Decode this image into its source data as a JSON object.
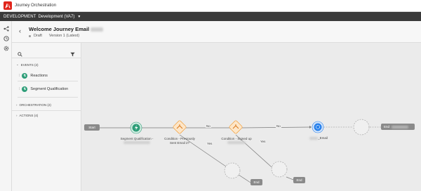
{
  "app": {
    "title": "Journey Orchestration"
  },
  "env": {
    "label": "DEVELOPMENT",
    "name": "Development (VA7)"
  },
  "journey": {
    "title": "Welcome Journey Email",
    "status": "Draft",
    "version": "Version 1 (Latest)"
  },
  "panel": {
    "events_section": "EVENTS (2)",
    "events": [
      "Reactions",
      "Segment Qualification"
    ],
    "orchestration_section": "ORCHESTRATION (2)",
    "actions_section": "ACTIONS (4)"
  },
  "canvas": {
    "start_label": "Start",
    "segment_label_1": "Segment Qualification -",
    "condition1_label_1": "Condition - Previously",
    "condition1_label_2": "Sent Email 2?",
    "condition2_label": "Condition - Signed up",
    "email_label": "_Email",
    "end_label": "End",
    "no_label": "No",
    "yes_label": "Yes"
  },
  "colors": {
    "accent_red": "#e1251b",
    "event_green": "#2d9d78",
    "condition_orange": "#f29423",
    "email_blue": "#2680eb"
  }
}
